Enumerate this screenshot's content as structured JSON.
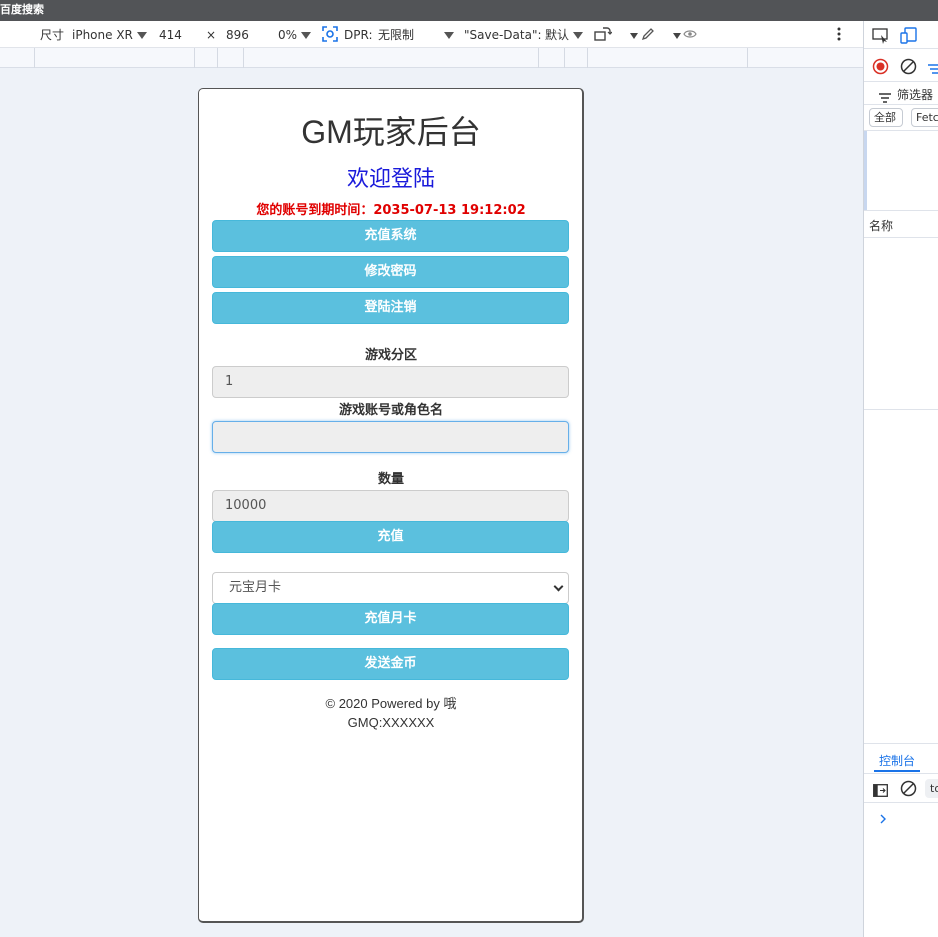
{
  "window": {
    "title_fragment": "百度搜索"
  },
  "device_toolbar": {
    "dimensions_label": "尺寸",
    "device": "iPhone XR",
    "width": "414",
    "times": "×",
    "height": "896",
    "zoom": "0%",
    "dpr_label": "DPR:",
    "dpr_value": "无限制",
    "save_data_label": "\"Save-Data\":",
    "save_data_value": "默认"
  },
  "page": {
    "title": "GM玩家后台",
    "welcome": "欢迎登陆",
    "expiry": "您的账号到期时间：2035-07-13 19:12:02",
    "buttons": {
      "recharge_system": "充值系统",
      "change_password": "修改密码",
      "logout": "登陆注销",
      "recharge": "充值",
      "recharge_monthly": "充值月卡",
      "send_gold": "发送金币"
    },
    "fields": {
      "zone_label": "游戏分区",
      "zone_value": "1",
      "account_label": "游戏账号或角色名",
      "account_value": "",
      "quantity_label": "数量",
      "quantity_value": "10000",
      "card_select_value": "元宝月卡"
    },
    "footer": {
      "line1": "© 2020 Powered by 哦",
      "line2": "GMQ:XXXXXX"
    }
  },
  "devtools": {
    "filter_label": "筛选器",
    "all_label": "全部",
    "fetch_label": "Fetc",
    "name_header": "名称",
    "console_tab": "控制台",
    "console_input": "to"
  },
  "colors": {
    "accent_button": "#5bc0de",
    "welcome_text": "#1a1adb",
    "expiry_text": "#e00000"
  }
}
